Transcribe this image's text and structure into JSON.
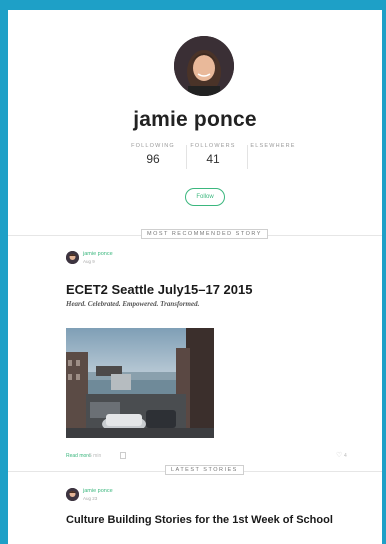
{
  "profile": {
    "name": "jamie ponce",
    "stats": [
      {
        "label": "FOLLOWING",
        "value": "96"
      },
      {
        "label": "FOLLOWERS",
        "value": "41"
      },
      {
        "label": "ELSEWHERE",
        "value": ""
      }
    ],
    "follow_label": "Follow"
  },
  "sections": {
    "recommended_label": "MOST RECOMMENDED STORY",
    "latest_label": "LATEST STORIES"
  },
  "recommended_story": {
    "author": "jamie ponce",
    "date": "Aug 9",
    "title": "ECET2 Seattle July15–17 2015",
    "subtitle": "Heard. Celebrated. Empowered. Transformed.",
    "read_more": "Read more",
    "read_time": "5 min",
    "recommends": "4"
  },
  "latest_story": {
    "author": "jamie ponce",
    "date": "Aug 23",
    "title": "Culture Building Stories for the 1st Week of School"
  },
  "colors": {
    "frame_border": "#1ea0c7",
    "accent_green": "#3bb77e"
  }
}
